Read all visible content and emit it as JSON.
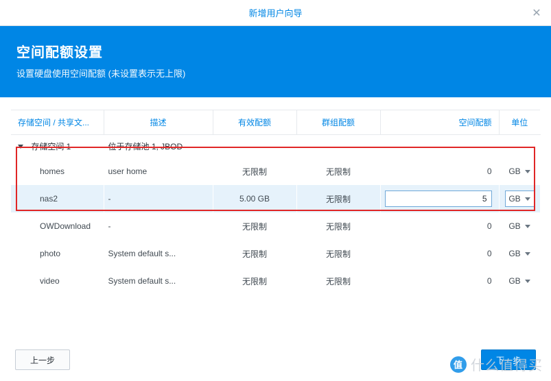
{
  "dialog": {
    "title": "新增用户向导",
    "close_glyph": "✕"
  },
  "header": {
    "heading": "空间配额设置",
    "subtitle": "设置硬盘使用空间配额 (未设置表示无上限)"
  },
  "columns": {
    "name": "存储空间 / 共享文...",
    "description": "描述",
    "effective_quota": "有效配额",
    "group_quota": "群组配额",
    "space_quota": "空间配额",
    "unit": "单位"
  },
  "group": {
    "label": "存储空间 1",
    "description": "位于存储池 1, JBOD"
  },
  "rows": [
    {
      "name": "homes",
      "desc": "user home",
      "effective": "无限制",
      "group": "无限制",
      "quota": "0",
      "unit": "GB",
      "selected": false
    },
    {
      "name": "nas2",
      "desc": "-",
      "effective": "5.00 GB",
      "group": "无限制",
      "quota": "5",
      "unit": "GB",
      "selected": true
    },
    {
      "name": "OWDownload",
      "desc": "-",
      "effective": "无限制",
      "group": "无限制",
      "quota": "0",
      "unit": "GB",
      "selected": false
    },
    {
      "name": "photo",
      "desc": "System default s...",
      "effective": "无限制",
      "group": "无限制",
      "quota": "0",
      "unit": "GB",
      "selected": false
    },
    {
      "name": "video",
      "desc": "System default s...",
      "effective": "无限制",
      "group": "无限制",
      "quota": "0",
      "unit": "GB",
      "selected": false
    }
  ],
  "footer": {
    "prev": "上一步",
    "next": "下一步"
  },
  "watermark": {
    "circle": "值",
    "text": "什么值得买"
  }
}
